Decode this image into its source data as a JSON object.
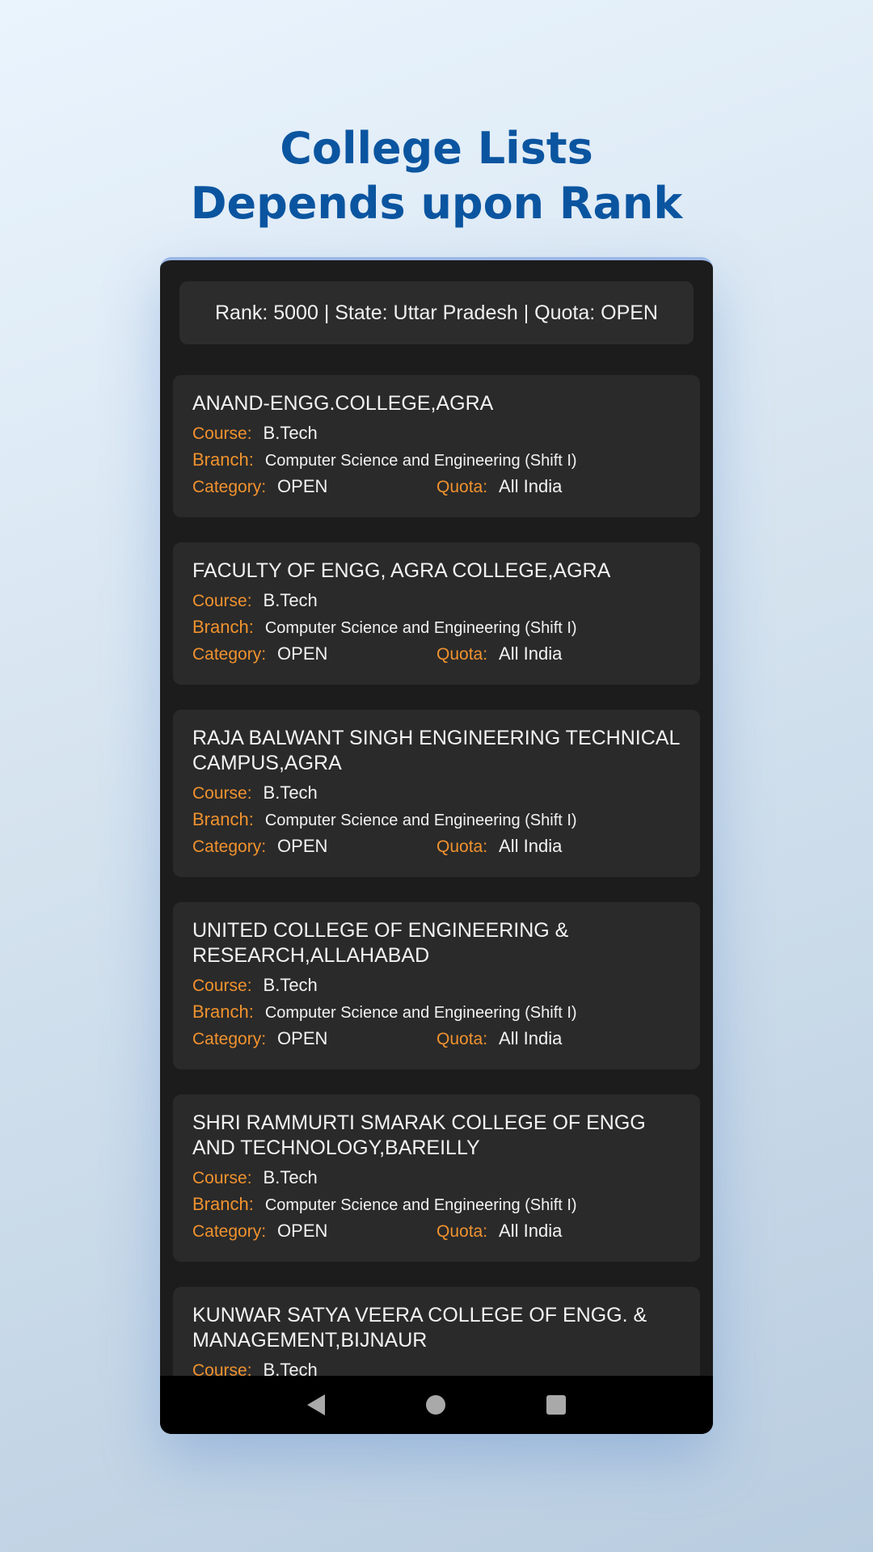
{
  "headline": {
    "line1": "College Lists",
    "line2": "Depends upon Rank"
  },
  "summary": "Rank: 5000 | State: Uttar Pradesh | Quota: OPEN",
  "labels": {
    "course": "Course:",
    "branch": "Branch:",
    "category": "Category:",
    "quota": "Quota:"
  },
  "colleges": [
    {
      "name": "ANAND-ENGG.COLLEGE,AGRA",
      "course": "B.Tech",
      "branch": "Computer Science and Engineering (Shift I)",
      "category": "OPEN",
      "quota": "All India"
    },
    {
      "name": "FACULTY OF ENGG, AGRA COLLEGE,AGRA",
      "course": "B.Tech",
      "branch": "Computer Science and Engineering (Shift I)",
      "category": "OPEN",
      "quota": "All India"
    },
    {
      "name": "RAJA BALWANT SINGH ENGINEERING TECHNICAL CAMPUS,AGRA",
      "course": "B.Tech",
      "branch": "Computer Science and Engineering (Shift I)",
      "category": "OPEN",
      "quota": "All India"
    },
    {
      "name": "UNITED COLLEGE OF ENGINEERING & RESEARCH,ALLAHABAD",
      "course": "B.Tech",
      "branch": "Computer Science and Engineering (Shift I)",
      "category": "OPEN",
      "quota": "All India"
    },
    {
      "name": "SHRI RAMMURTI SMARAK COLLEGE OF ENGG AND TECHNOLOGY,BAREILLY",
      "course": "B.Tech",
      "branch": "Computer Science and Engineering (Shift I)",
      "category": "OPEN",
      "quota": "All India"
    },
    {
      "name": "KUNWAR SATYA VEERA COLLEGE OF ENGG. & MANAGEMENT,BIJNAUR",
      "course": "B.Tech"
    }
  ],
  "navbar": {
    "icons": [
      "back-icon",
      "home-icon",
      "recents-icon"
    ]
  }
}
